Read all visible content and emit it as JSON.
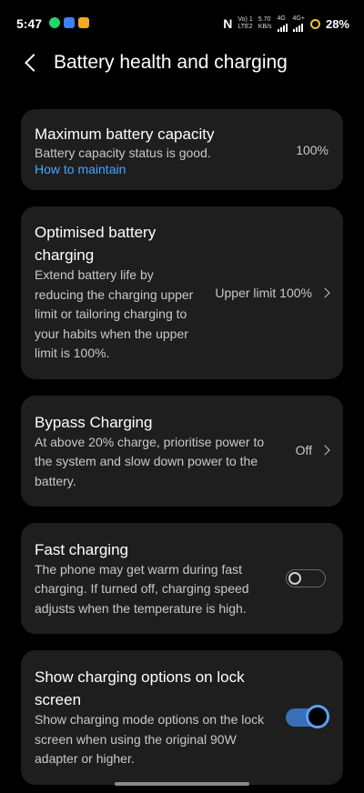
{
  "status": {
    "time": "5:47",
    "n_icon": "N",
    "volte_line1": "Vo) 1",
    "volte_line2": "LTE2",
    "speed_line1": "5.70",
    "speed_line2": "KB/s",
    "net1": "4G",
    "net2": "4G+",
    "battery": "28%"
  },
  "header": {
    "title": "Battery health and charging"
  },
  "capacity": {
    "title": "Maximum battery capacity",
    "desc": "Battery capacity status is good.",
    "link": "How to maintain",
    "value": "100%"
  },
  "optimised": {
    "title_l1": "Optimised battery",
    "title_l2": "charging",
    "desc_l1": "Extend battery life by",
    "desc_l2": "reducing the charging upper",
    "desc_l3": "limit or tailoring charging to",
    "desc_l4": "your habits when the upper",
    "desc_l5": "limit is 100%.",
    "value": "Upper limit 100%"
  },
  "bypass": {
    "title": "Bypass Charging",
    "desc_l1": "At above 20% charge, prioritise power to",
    "desc_l2": "the system and slow down power to the",
    "desc_l3": "battery.",
    "value": "Off"
  },
  "fast": {
    "title": "Fast charging",
    "desc_l1": "The phone may get warm during fast",
    "desc_l2": "charging. If turned off, charging speed",
    "desc_l3": "adjusts when the temperature is high.",
    "enabled": false
  },
  "lockscreen": {
    "title_l1": "Show charging options on lock",
    "title_l2": "screen",
    "desc_l1": "Show charging mode options on the lock",
    "desc_l2": "screen when using the original 90W",
    "desc_l3": "adapter or higher.",
    "enabled": true
  },
  "colors": {
    "link": "#4aa3ff",
    "toggle_on": "#3a6fb6",
    "card": "#1e1e1e"
  }
}
